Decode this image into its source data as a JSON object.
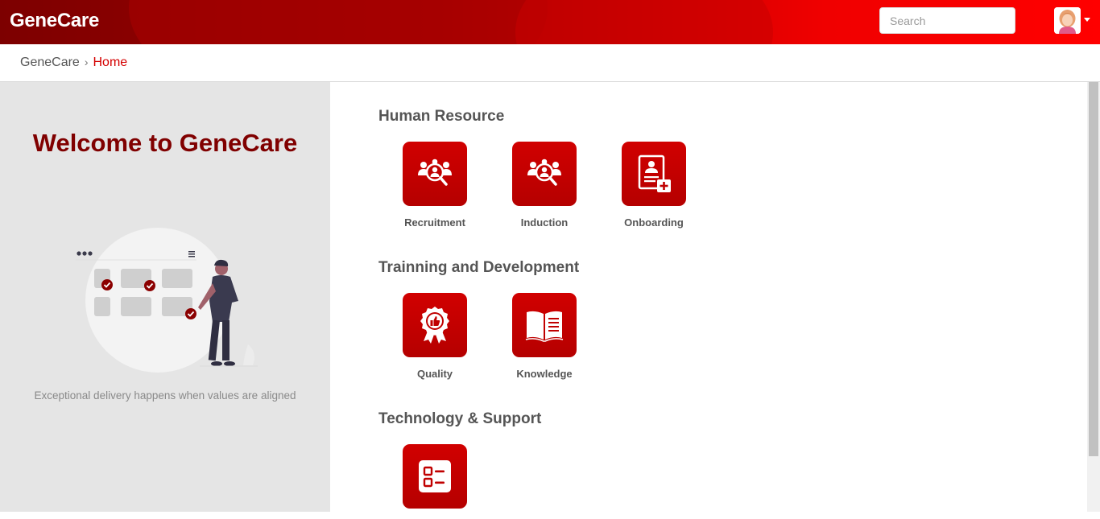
{
  "header": {
    "brand": "GeneCare",
    "search_placeholder": "Search",
    "avatar_icon": "user-avatar-icon"
  },
  "breadcrumb": {
    "root": "GeneCare",
    "separator": "›",
    "current": "Home"
  },
  "welcome": {
    "title": "Welcome to GeneCare",
    "tagline": "Exceptional delivery happens when values are aligned"
  },
  "sections": [
    {
      "title": "Human Resource",
      "tiles": [
        {
          "label": "Recruitment",
          "icon": "recruitment-search-people-icon"
        },
        {
          "label": "Induction",
          "icon": "induction-search-people-icon"
        },
        {
          "label": "Onboarding",
          "icon": "onboarding-document-icon"
        }
      ]
    },
    {
      "title": "Trainning and Development",
      "tiles": [
        {
          "label": "Quality",
          "icon": "quality-award-icon"
        },
        {
          "label": "Knowledge",
          "icon": "knowledge-book-icon"
        }
      ]
    },
    {
      "title": "Technology & Support",
      "tiles": [
        {
          "label": "",
          "icon": "checklist-icon"
        }
      ]
    }
  ],
  "colors": {
    "brand_dark": "#800000",
    "brand_red": "#d10000",
    "header_bright": "#ff0000",
    "breadcrumb_active": "#d40000",
    "left_panel_bg": "#e5e5e5"
  }
}
